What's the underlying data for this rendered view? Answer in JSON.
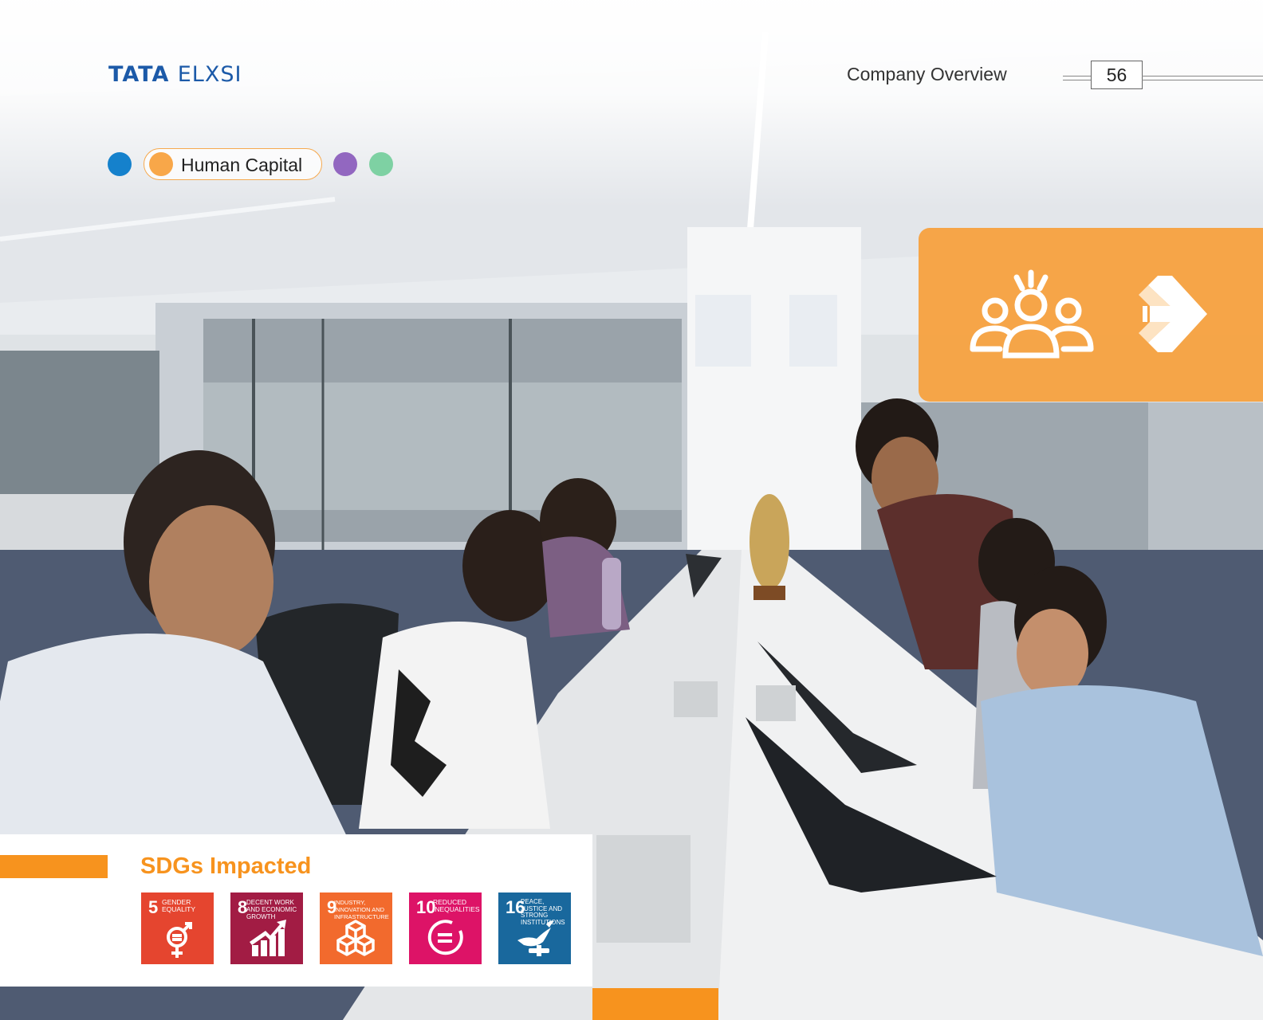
{
  "header": {
    "brand_first": "TATA",
    "brand_second": "ELXSI",
    "section": "Company Overview",
    "page": "56"
  },
  "pillars": {
    "active_label": "Human Capital",
    "colors": [
      "#1581cc",
      "#f8a749",
      "#9267c0",
      "#7ed1a3"
    ]
  },
  "callout": {
    "icons": [
      "people-group-icon",
      "arrow-right-icon"
    ],
    "color": "#f7a03e"
  },
  "sdgs": {
    "title": "SDGs Impacted",
    "goals": [
      {
        "number": "5",
        "label": "GENDER EQUALITY",
        "color": "#e5452f",
        "icon": "gender-equality-icon"
      },
      {
        "number": "8",
        "label": "DECENT WORK AND ECONOMIC GROWTH",
        "color": "#a21c44",
        "icon": "growth-chart-icon"
      },
      {
        "number": "9",
        "label": "INDUSTRY, INNOVATION AND INFRASTRUCTURE",
        "color": "#f26a2d",
        "icon": "cubes-icon"
      },
      {
        "number": "10",
        "label": "REDUCED INEQUALITIES",
        "color": "#dd1367",
        "icon": "equality-circle-icon"
      },
      {
        "number": "16",
        "label": "PEACE, JUSTICE AND STRONG INSTITUTIONS",
        "color": "#19689d",
        "icon": "dove-gavel-icon"
      }
    ]
  }
}
